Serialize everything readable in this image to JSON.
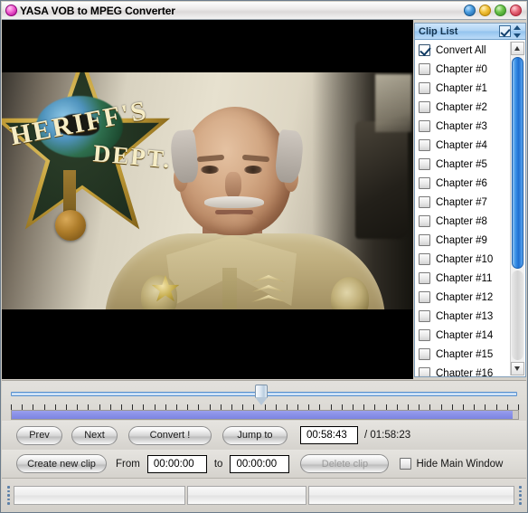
{
  "window": {
    "title": "YASA VOB to MPEG Converter",
    "app_icon": "app-circle-icon",
    "buttons": [
      {
        "name": "minimize",
        "icon": "circle-blue-icon",
        "color": "#4a9de0"
      },
      {
        "name": "maximize",
        "icon": "circle-yellow-icon",
        "color": "#f3c33c"
      },
      {
        "name": "restore",
        "icon": "circle-green-icon",
        "color": "#6cc44a"
      },
      {
        "name": "close",
        "icon": "circle-red-icon",
        "color": "#e86a7c"
      }
    ]
  },
  "video": {
    "alt": "Sheriff's deputy seated in front of a SHERIFF'S DEPT star plaque",
    "plaque_line1": "HERIFF'S",
    "plaque_line2": "DEPT."
  },
  "cliplist": {
    "title": "Clip List",
    "header_check_icon": "checkbox-checked-icon",
    "header_sort_icon": "sort-updown-icon",
    "scroll_up_icon": "triangle-up-icon",
    "scroll_down_icon": "triangle-down-icon",
    "items": [
      {
        "label": "Convert All",
        "checked": true
      },
      {
        "label": "Chapter #0",
        "checked": false
      },
      {
        "label": "Chapter #1",
        "checked": false
      },
      {
        "label": "Chapter #2",
        "checked": false
      },
      {
        "label": "Chapter #3",
        "checked": false
      },
      {
        "label": "Chapter #4",
        "checked": false
      },
      {
        "label": "Chapter #5",
        "checked": false
      },
      {
        "label": "Chapter #6",
        "checked": false
      },
      {
        "label": "Chapter #7",
        "checked": false
      },
      {
        "label": "Chapter #8",
        "checked": false
      },
      {
        "label": "Chapter #9",
        "checked": false
      },
      {
        "label": "Chapter #10",
        "checked": false
      },
      {
        "label": "Chapter #11",
        "checked": false
      },
      {
        "label": "Chapter #12",
        "checked": false
      },
      {
        "label": "Chapter #13",
        "checked": false
      },
      {
        "label": "Chapter #14",
        "checked": false
      },
      {
        "label": "Chapter #15",
        "checked": false
      },
      {
        "label": "Chapter #16",
        "checked": false
      }
    ]
  },
  "seek": {
    "position_percent": 49.5,
    "progress_percent": 99,
    "tick_count": 47
  },
  "controls": {
    "prev_label": "Prev",
    "next_label": "Next",
    "convert_label": "Convert !",
    "jump_to_label": "Jump to",
    "current_time": "00:58:43",
    "total_time": "/ 01:58:23",
    "create_clip_label": "Create new clip",
    "from_label": "From",
    "from_value": "00:00:00",
    "to_label": "to",
    "to_value": "00:00:00",
    "delete_clip_label": "Delete clip",
    "hide_main_window_label": "Hide Main Window",
    "hide_main_window_checked": false
  },
  "statusbar": {
    "panel1": "",
    "panel2": "",
    "panel3": ""
  }
}
